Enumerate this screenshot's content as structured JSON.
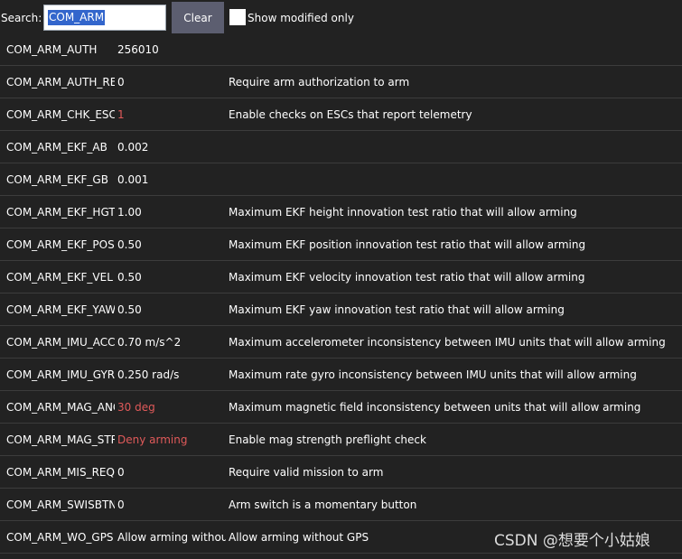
{
  "search": {
    "label": "Search:",
    "value": "COM_ARM",
    "clear_label": "Clear",
    "show_modified_label": "Show modified only"
  },
  "params": [
    {
      "name": "COM_ARM_AUTH",
      "value": "256010",
      "desc": "",
      "modified": false
    },
    {
      "name": "COM_ARM_AUTH_REQ",
      "value": "0",
      "desc": "Require arm authorization to arm",
      "modified": false
    },
    {
      "name": "COM_ARM_CHK_ESCS",
      "value": "1",
      "desc": "Enable checks on ESCs that report telemetry",
      "modified": true
    },
    {
      "name": "COM_ARM_EKF_AB",
      "value": "0.002",
      "desc": "",
      "modified": false
    },
    {
      "name": "COM_ARM_EKF_GB",
      "value": "0.001",
      "desc": "",
      "modified": false
    },
    {
      "name": "COM_ARM_EKF_HGT",
      "value": "1.00",
      "desc": "Maximum EKF height innovation test ratio that will allow arming",
      "modified": false
    },
    {
      "name": "COM_ARM_EKF_POS",
      "value": "0.50",
      "desc": "Maximum EKF position innovation test ratio that will allow arming",
      "modified": false
    },
    {
      "name": "COM_ARM_EKF_VEL",
      "value": "0.50",
      "desc": "Maximum EKF velocity innovation test ratio that will allow arming",
      "modified": false
    },
    {
      "name": "COM_ARM_EKF_YAW",
      "value": "0.50",
      "desc": "Maximum EKF yaw innovation test ratio that will allow arming",
      "modified": false
    },
    {
      "name": "COM_ARM_IMU_ACC",
      "value": "0.70 m/s^2",
      "desc": "Maximum accelerometer inconsistency between IMU units that will allow arming",
      "modified": false
    },
    {
      "name": "COM_ARM_IMU_GYR",
      "value": "0.250 rad/s",
      "desc": "Maximum rate gyro inconsistency between IMU units that will allow arming",
      "modified": false
    },
    {
      "name": "COM_ARM_MAG_ANG",
      "value": "30 deg",
      "desc": "Maximum magnetic field inconsistency between units that will allow arming",
      "modified": true
    },
    {
      "name": "COM_ARM_MAG_STR",
      "value": "Deny arming",
      "desc": "Enable mag strength preflight check",
      "modified": true
    },
    {
      "name": "COM_ARM_MIS_REQ",
      "value": "0",
      "desc": "Require valid mission to arm",
      "modified": false
    },
    {
      "name": "COM_ARM_SWISBTN",
      "value": "0",
      "desc": "Arm switch is a momentary button",
      "modified": false
    },
    {
      "name": "COM_ARM_WO_GPS",
      "value": "Allow arming without",
      "desc": "Allow arming without GPS",
      "modified": false
    }
  ],
  "watermark": "CSDN @想要个小姑娘",
  "colors": {
    "background": "#222222",
    "modified_value": "#e05a5a",
    "selection": "#3366cc",
    "clear_button": "#5c5e70"
  }
}
